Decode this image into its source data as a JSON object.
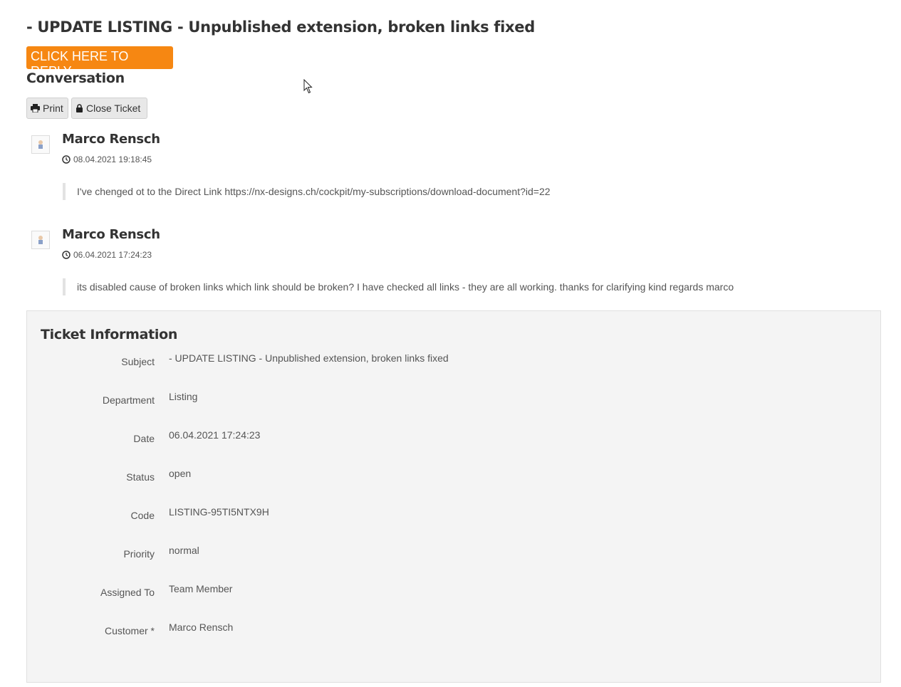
{
  "ticket": {
    "title": "- UPDATE LISTING - Unpublished extension, broken links fixed",
    "reply_label": "CLICK HERE TO REPLY"
  },
  "conversation": {
    "heading": "Conversation",
    "toolbar": {
      "print_label": "Print",
      "close_label": "Close Ticket"
    },
    "messages": [
      {
        "author": "Marco Rensch",
        "timestamp": "08.04.2021 19:18:45",
        "body": "I've chenged ot to the Direct Link https://nx-designs.ch/cockpit/my-subscriptions/download-document?id=22"
      },
      {
        "author": "Marco Rensch",
        "timestamp": "06.04.2021 17:24:23",
        "body": "its disabled cause of broken links which link should be broken? I have checked all links - they are all working.   thanks for clarifying    kind regards marco"
      }
    ]
  },
  "info": {
    "heading": "Ticket Information",
    "rows": [
      {
        "label": "Subject",
        "value": "- UPDATE LISTING - Unpublished extension, broken links fixed"
      },
      {
        "label": "Department",
        "value": "Listing"
      },
      {
        "label": "Date",
        "value": "06.04.2021 17:24:23"
      },
      {
        "label": "Status",
        "value": "open"
      },
      {
        "label": "Code",
        "value": "LISTING-95TI5NTX9H"
      },
      {
        "label": "Priority",
        "value": "normal"
      },
      {
        "label": "Assigned To",
        "value": "Team Member"
      },
      {
        "label": "Customer *",
        "value": "Marco Rensch"
      }
    ]
  },
  "colors": {
    "reply_button": "#f68712",
    "panel_background": "#f4f4f4"
  },
  "icons": {
    "print": "printer-icon",
    "close": "lock-icon",
    "timestamp": "clock-icon",
    "avatar": "user-avatar-icon",
    "cursor": "mouse-pointer-icon"
  }
}
